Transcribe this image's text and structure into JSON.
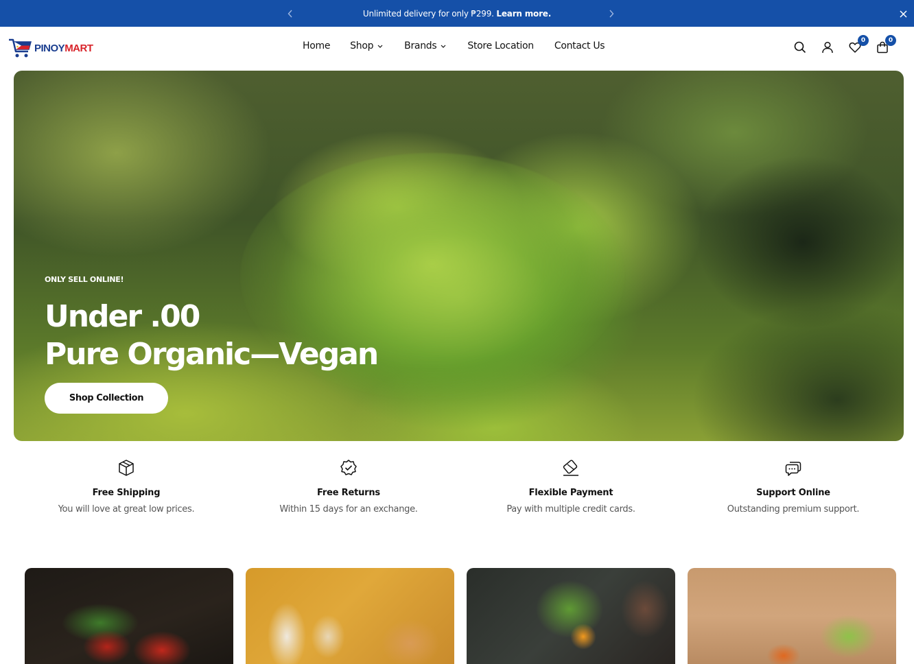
{
  "announcement": {
    "text": "Unlimited delivery for only ₱299.",
    "link": "Learn more."
  },
  "header": {
    "logo": {
      "part1": "PINOY",
      "part2": "MART"
    },
    "nav": [
      {
        "label": "Home"
      },
      {
        "label": "Shop"
      },
      {
        "label": "Brands"
      },
      {
        "label": "Store Location"
      },
      {
        "label": "Contact Us"
      }
    ],
    "wishlist_count": "0",
    "cart_count": "0"
  },
  "hero": {
    "eyebrow": "ONLY SELL ONLINE!",
    "title_line1": "Under .00",
    "title_line2": "Pure Organic—Vegan",
    "button": "Shop Collection"
  },
  "features": [
    {
      "icon": "box-icon",
      "title": "Free Shipping",
      "desc": "You will love at great low prices."
    },
    {
      "icon": "badge-check-icon",
      "title": "Free Returns",
      "desc": "Within 15 days for an exchange."
    },
    {
      "icon": "credit-card-icon",
      "title": "Flexible Payment",
      "desc": "Pay with multiple credit cards."
    },
    {
      "icon": "chat-icon",
      "title": "Support Online",
      "desc": "Outstanding premium support."
    }
  ],
  "colors": {
    "accent": "#1550a8",
    "logo_blue": "#1a3d8f",
    "logo_red": "#d8232a"
  }
}
